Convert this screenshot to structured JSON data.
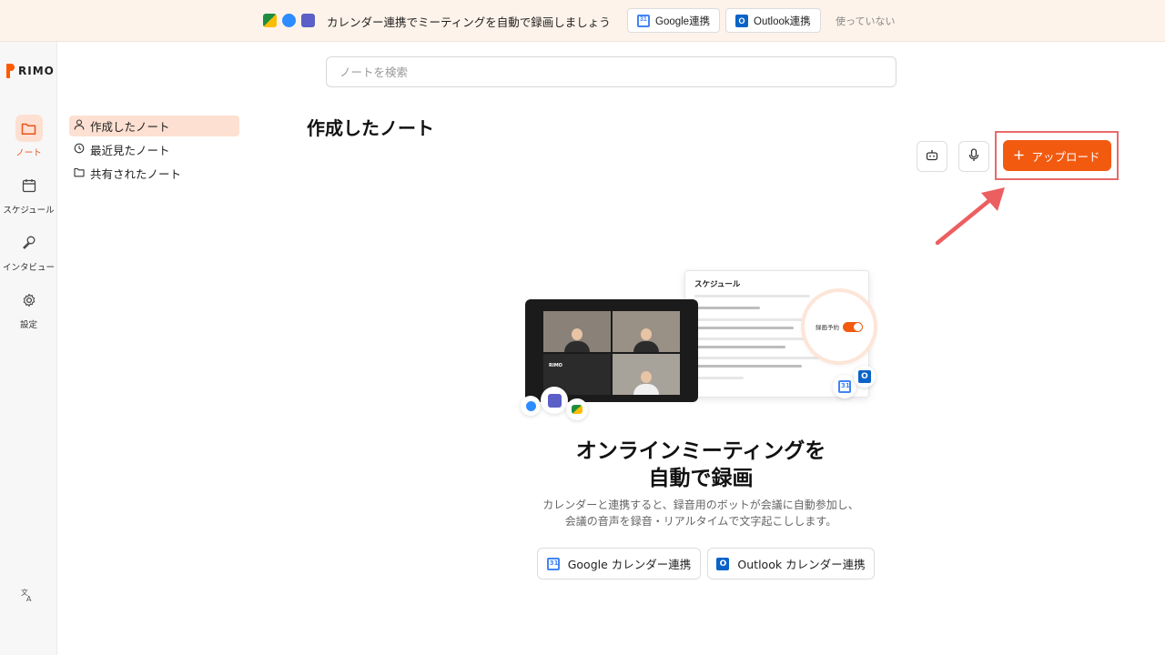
{
  "banner": {
    "message": "カレンダー連携でミーティングを自動で録画しましょう",
    "google_button": "Google連携",
    "outlook_button": "Outlook連携",
    "unused_link": "使っていない"
  },
  "brand": {
    "logo_text": "RIMO",
    "accent_color": "#f25a10"
  },
  "rail": {
    "items": [
      {
        "label": "ノート",
        "icon": "folder-icon",
        "active": true
      },
      {
        "label": "スケジュール",
        "icon": "calendar-icon",
        "active": false
      },
      {
        "label": "インタビュー",
        "icon": "microphone-icon",
        "active": false
      },
      {
        "label": "設定",
        "icon": "gear-icon",
        "active": false
      }
    ],
    "language_icon": "translate-icon"
  },
  "search": {
    "placeholder": "ノートを検索"
  },
  "nav": {
    "items": [
      {
        "label": "作成したノート",
        "icon": "user-icon",
        "active": true
      },
      {
        "label": "最近見たノート",
        "icon": "history-icon",
        "active": false
      },
      {
        "label": "共有されたノート",
        "icon": "folder-icon",
        "active": false
      }
    ]
  },
  "main": {
    "title": "作成したノート",
    "upload_button": "アップロード",
    "empty_state": {
      "headline_line1": "オンラインミーティングを",
      "headline_line2": "自動で録画",
      "desc_line1": "カレンダーと連携すると、録音用のボットが会議に自動参加し、",
      "desc_line2": "会議の音声を録音・リアルタイムで文字起こしします。",
      "google_button": "Google カレンダー連携",
      "outlook_button": "Outlook カレンダー連携"
    }
  },
  "illustration": {
    "schedule_title": "スケジュール",
    "toggle_label": "録画予約",
    "tile_logo": "RIMO"
  }
}
